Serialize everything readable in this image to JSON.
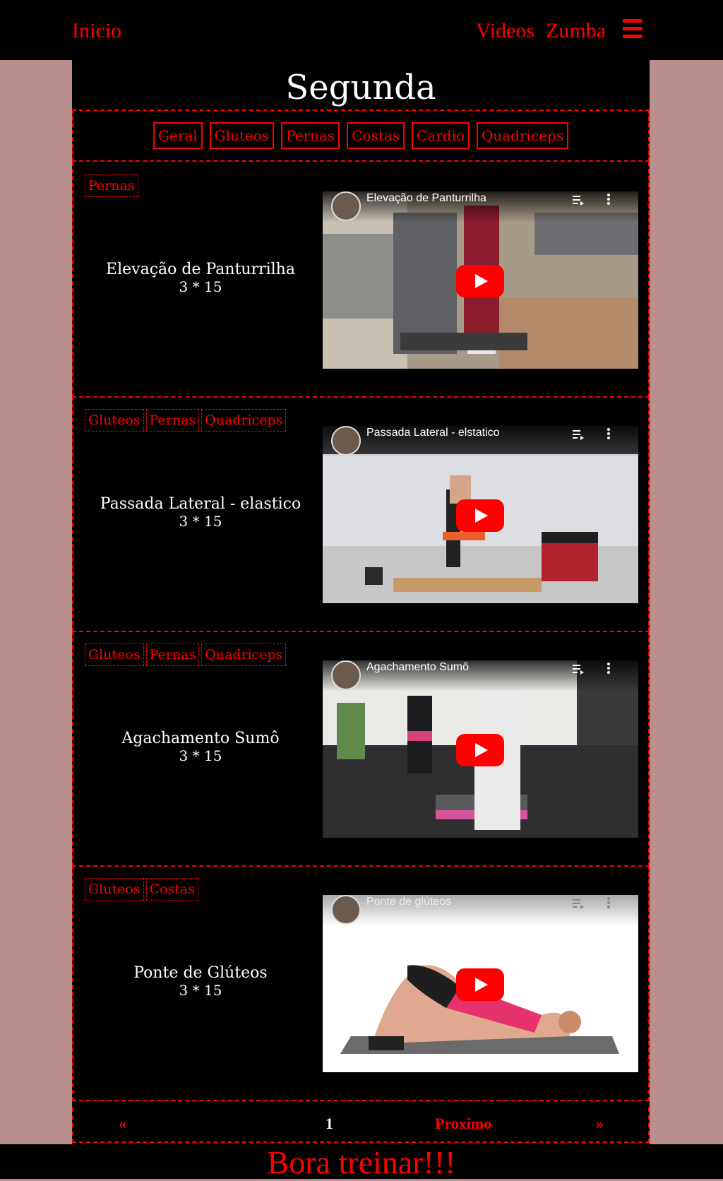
{
  "nav": {
    "home": "Inicio",
    "links": [
      "Videos",
      "Zumba"
    ],
    "menu_icon": "hamburger-menu-icon"
  },
  "day_title": "Segunda",
  "filters": [
    "Geral",
    "Gluteos",
    "Pernas",
    "Costas",
    "Cardio",
    "Quadriceps"
  ],
  "exercises": [
    {
      "tags": [
        "Pernas"
      ],
      "name": "Elevação de Panturrilha",
      "sets": "3 * 15",
      "video_title": "Elevação de Panturrilha"
    },
    {
      "tags": [
        "Gluteos",
        "Pernas",
        "Quadriceps"
      ],
      "name": "Passada Lateral - elastico",
      "sets": "3 * 15",
      "video_title": "Passada Lateral - elstatico"
    },
    {
      "tags": [
        "Gluteos",
        "Pernas",
        "Quadriceps"
      ],
      "name": "Agachamento Sumô",
      "sets": "3 * 15",
      "video_title": "Agachamento Sumô"
    },
    {
      "tags": [
        "Gluteos",
        "Costas"
      ],
      "name": "Ponte de Glúteos",
      "sets": "3 * 15",
      "video_title": "Ponte de glúteos"
    }
  ],
  "pagination": {
    "prev": "«",
    "current": "1",
    "next_label": "Proximo",
    "next": "»"
  },
  "footer": "Bora treinar!!!",
  "colors": {
    "accent": "#ff0000",
    "page_bg": "#bc8f8f",
    "panel_bg": "#000000"
  }
}
